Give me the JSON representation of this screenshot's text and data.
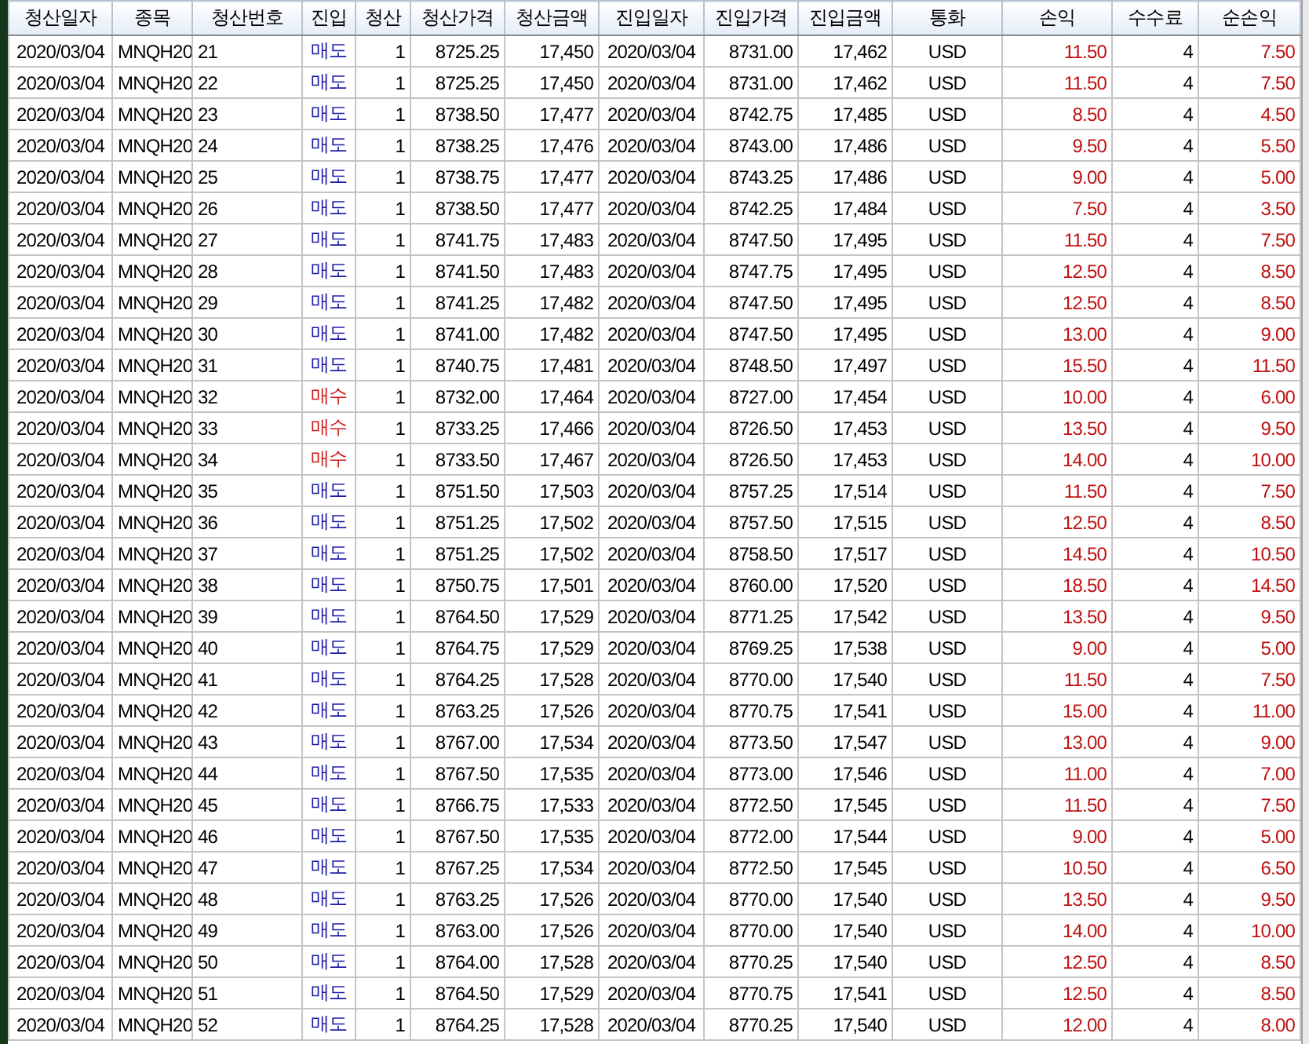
{
  "table": {
    "columns": [
      "청산일자",
      "종목",
      "청산번호",
      "진입",
      "청산",
      "청산가격",
      "청산금액",
      "진입일자",
      "진입가격",
      "진입금액",
      "통화",
      "손익",
      "수수료",
      "순손익"
    ],
    "rows": [
      {
        "kind": "sell",
        "cells": [
          "2020/03/04",
          "MNQH20",
          "21",
          "매도",
          "1",
          "8725.25",
          "17,450",
          "2020/03/04",
          "8731.00",
          "17,462",
          "USD",
          "11.50",
          "4",
          "7.50"
        ]
      },
      {
        "kind": "sell",
        "cells": [
          "2020/03/04",
          "MNQH20",
          "22",
          "매도",
          "1",
          "8725.25",
          "17,450",
          "2020/03/04",
          "8731.00",
          "17,462",
          "USD",
          "11.50",
          "4",
          "7.50"
        ]
      },
      {
        "kind": "sell",
        "cells": [
          "2020/03/04",
          "MNQH20",
          "23",
          "매도",
          "1",
          "8738.50",
          "17,477",
          "2020/03/04",
          "8742.75",
          "17,485",
          "USD",
          "8.50",
          "4",
          "4.50"
        ]
      },
      {
        "kind": "sell",
        "cells": [
          "2020/03/04",
          "MNQH20",
          "24",
          "매도",
          "1",
          "8738.25",
          "17,476",
          "2020/03/04",
          "8743.00",
          "17,486",
          "USD",
          "9.50",
          "4",
          "5.50"
        ]
      },
      {
        "kind": "sell",
        "cells": [
          "2020/03/04",
          "MNQH20",
          "25",
          "매도",
          "1",
          "8738.75",
          "17,477",
          "2020/03/04",
          "8743.25",
          "17,486",
          "USD",
          "9.00",
          "4",
          "5.00"
        ]
      },
      {
        "kind": "sell",
        "cells": [
          "2020/03/04",
          "MNQH20",
          "26",
          "매도",
          "1",
          "8738.50",
          "17,477",
          "2020/03/04",
          "8742.25",
          "17,484",
          "USD",
          "7.50",
          "4",
          "3.50"
        ]
      },
      {
        "kind": "sell",
        "cells": [
          "2020/03/04",
          "MNQH20",
          "27",
          "매도",
          "1",
          "8741.75",
          "17,483",
          "2020/03/04",
          "8747.50",
          "17,495",
          "USD",
          "11.50",
          "4",
          "7.50"
        ]
      },
      {
        "kind": "sell",
        "cells": [
          "2020/03/04",
          "MNQH20",
          "28",
          "매도",
          "1",
          "8741.50",
          "17,483",
          "2020/03/04",
          "8747.75",
          "17,495",
          "USD",
          "12.50",
          "4",
          "8.50"
        ]
      },
      {
        "kind": "sell",
        "cells": [
          "2020/03/04",
          "MNQH20",
          "29",
          "매도",
          "1",
          "8741.25",
          "17,482",
          "2020/03/04",
          "8747.50",
          "17,495",
          "USD",
          "12.50",
          "4",
          "8.50"
        ]
      },
      {
        "kind": "sell",
        "cells": [
          "2020/03/04",
          "MNQH20",
          "30",
          "매도",
          "1",
          "8741.00",
          "17,482",
          "2020/03/04",
          "8747.50",
          "17,495",
          "USD",
          "13.00",
          "4",
          "9.00"
        ]
      },
      {
        "kind": "sell",
        "cells": [
          "2020/03/04",
          "MNQH20",
          "31",
          "매도",
          "1",
          "8740.75",
          "17,481",
          "2020/03/04",
          "8748.50",
          "17,497",
          "USD",
          "15.50",
          "4",
          "11.50"
        ]
      },
      {
        "kind": "buy",
        "cells": [
          "2020/03/04",
          "MNQH20",
          "32",
          "매수",
          "1",
          "8732.00",
          "17,464",
          "2020/03/04",
          "8727.00",
          "17,454",
          "USD",
          "10.00",
          "4",
          "6.00"
        ]
      },
      {
        "kind": "buy",
        "cells": [
          "2020/03/04",
          "MNQH20",
          "33",
          "매수",
          "1",
          "8733.25",
          "17,466",
          "2020/03/04",
          "8726.50",
          "17,453",
          "USD",
          "13.50",
          "4",
          "9.50"
        ]
      },
      {
        "kind": "buy",
        "cells": [
          "2020/03/04",
          "MNQH20",
          "34",
          "매수",
          "1",
          "8733.50",
          "17,467",
          "2020/03/04",
          "8726.50",
          "17,453",
          "USD",
          "14.00",
          "4",
          "10.00"
        ]
      },
      {
        "kind": "sell",
        "cells": [
          "2020/03/04",
          "MNQH20",
          "35",
          "매도",
          "1",
          "8751.50",
          "17,503",
          "2020/03/04",
          "8757.25",
          "17,514",
          "USD",
          "11.50",
          "4",
          "7.50"
        ]
      },
      {
        "kind": "sell",
        "cells": [
          "2020/03/04",
          "MNQH20",
          "36",
          "매도",
          "1",
          "8751.25",
          "17,502",
          "2020/03/04",
          "8757.50",
          "17,515",
          "USD",
          "12.50",
          "4",
          "8.50"
        ]
      },
      {
        "kind": "sell",
        "cells": [
          "2020/03/04",
          "MNQH20",
          "37",
          "매도",
          "1",
          "8751.25",
          "17,502",
          "2020/03/04",
          "8758.50",
          "17,517",
          "USD",
          "14.50",
          "4",
          "10.50"
        ]
      },
      {
        "kind": "sell",
        "cells": [
          "2020/03/04",
          "MNQH20",
          "38",
          "매도",
          "1",
          "8750.75",
          "17,501",
          "2020/03/04",
          "8760.00",
          "17,520",
          "USD",
          "18.50",
          "4",
          "14.50"
        ]
      },
      {
        "kind": "sell",
        "cells": [
          "2020/03/04",
          "MNQH20",
          "39",
          "매도",
          "1",
          "8764.50",
          "17,529",
          "2020/03/04",
          "8771.25",
          "17,542",
          "USD",
          "13.50",
          "4",
          "9.50"
        ]
      },
      {
        "kind": "sell",
        "cells": [
          "2020/03/04",
          "MNQH20",
          "40",
          "매도",
          "1",
          "8764.75",
          "17,529",
          "2020/03/04",
          "8769.25",
          "17,538",
          "USD",
          "9.00",
          "4",
          "5.00"
        ]
      },
      {
        "kind": "sell",
        "cells": [
          "2020/03/04",
          "MNQH20",
          "41",
          "매도",
          "1",
          "8764.25",
          "17,528",
          "2020/03/04",
          "8770.00",
          "17,540",
          "USD",
          "11.50",
          "4",
          "7.50"
        ]
      },
      {
        "kind": "sell",
        "cells": [
          "2020/03/04",
          "MNQH20",
          "42",
          "매도",
          "1",
          "8763.25",
          "17,526",
          "2020/03/04",
          "8770.75",
          "17,541",
          "USD",
          "15.00",
          "4",
          "11.00"
        ]
      },
      {
        "kind": "sell",
        "cells": [
          "2020/03/04",
          "MNQH20",
          "43",
          "매도",
          "1",
          "8767.00",
          "17,534",
          "2020/03/04",
          "8773.50",
          "17,547",
          "USD",
          "13.00",
          "4",
          "9.00"
        ]
      },
      {
        "kind": "sell",
        "cells": [
          "2020/03/04",
          "MNQH20",
          "44",
          "매도",
          "1",
          "8767.50",
          "17,535",
          "2020/03/04",
          "8773.00",
          "17,546",
          "USD",
          "11.00",
          "4",
          "7.00"
        ]
      },
      {
        "kind": "sell",
        "cells": [
          "2020/03/04",
          "MNQH20",
          "45",
          "매도",
          "1",
          "8766.75",
          "17,533",
          "2020/03/04",
          "8772.50",
          "17,545",
          "USD",
          "11.50",
          "4",
          "7.50"
        ]
      },
      {
        "kind": "sell",
        "cells": [
          "2020/03/04",
          "MNQH20",
          "46",
          "매도",
          "1",
          "8767.50",
          "17,535",
          "2020/03/04",
          "8772.00",
          "17,544",
          "USD",
          "9.00",
          "4",
          "5.00"
        ]
      },
      {
        "kind": "sell",
        "cells": [
          "2020/03/04",
          "MNQH20",
          "47",
          "매도",
          "1",
          "8767.25",
          "17,534",
          "2020/03/04",
          "8772.50",
          "17,545",
          "USD",
          "10.50",
          "4",
          "6.50"
        ]
      },
      {
        "kind": "sell",
        "cells": [
          "2020/03/04",
          "MNQH20",
          "48",
          "매도",
          "1",
          "8763.25",
          "17,526",
          "2020/03/04",
          "8770.00",
          "17,540",
          "USD",
          "13.50",
          "4",
          "9.50"
        ]
      },
      {
        "kind": "sell",
        "cells": [
          "2020/03/04",
          "MNQH20",
          "49",
          "매도",
          "1",
          "8763.00",
          "17,526",
          "2020/03/04",
          "8770.00",
          "17,540",
          "USD",
          "14.00",
          "4",
          "10.00"
        ]
      },
      {
        "kind": "sell",
        "cells": [
          "2020/03/04",
          "MNQH20",
          "50",
          "매도",
          "1",
          "8764.00",
          "17,528",
          "2020/03/04",
          "8770.25",
          "17,540",
          "USD",
          "12.50",
          "4",
          "8.50"
        ]
      },
      {
        "kind": "sell",
        "cells": [
          "2020/03/04",
          "MNQH20",
          "51",
          "매도",
          "1",
          "8764.50",
          "17,529",
          "2020/03/04",
          "8770.75",
          "17,541",
          "USD",
          "12.50",
          "4",
          "8.50"
        ]
      },
      {
        "kind": "sell",
        "cells": [
          "2020/03/04",
          "MNQH20",
          "52",
          "매도",
          "1",
          "8764.25",
          "17,528",
          "2020/03/04",
          "8770.25",
          "17,540",
          "USD",
          "12.00",
          "4",
          "8.00"
        ]
      }
    ]
  }
}
